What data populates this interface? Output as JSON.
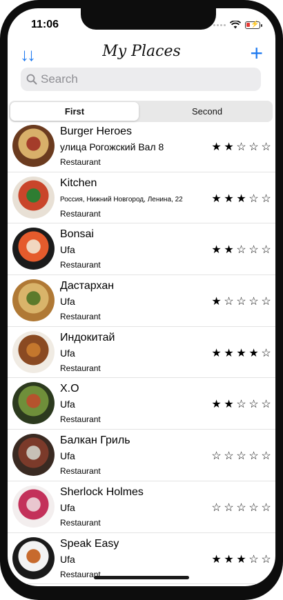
{
  "status_bar": {
    "time": "11:06"
  },
  "nav": {
    "title": "My Places",
    "sort_icon": "↓↓",
    "add_icon": "+"
  },
  "search": {
    "placeholder": "Search"
  },
  "segments": [
    {
      "label": "First"
    },
    {
      "label": "Second"
    }
  ],
  "places": [
    {
      "name": "Burger Heroes",
      "location": "улица Рогожский Вал 8",
      "type": "Restaurant",
      "rating": 2,
      "colors": [
        "#6b3b1f",
        "#d8b06a",
        "#a43c2a"
      ]
    },
    {
      "name": "Kitchen",
      "location": "Россия, Нижний Новгород, Ленина, 22",
      "type": "Restaurant",
      "rating": 3,
      "colors": [
        "#e8e0d5",
        "#c9452a",
        "#2e7d32"
      ]
    },
    {
      "name": "Bonsai",
      "location": "Ufa",
      "type": "Restaurant",
      "rating": 2,
      "colors": [
        "#1b1b1b",
        "#e55b2c",
        "#f1d7c0"
      ]
    },
    {
      "name": "Дастархан",
      "location": "Ufa",
      "type": "Restaurant",
      "rating": 1,
      "colors": [
        "#b07935",
        "#d9b46a",
        "#5c7a2b"
      ]
    },
    {
      "name": "Индокитай",
      "location": "Ufa",
      "type": "Restaurant",
      "rating": 4,
      "colors": [
        "#f0ebe3",
        "#8a4a22",
        "#c4772d"
      ]
    },
    {
      "name": "X.O",
      "location": "Ufa",
      "type": "Restaurant",
      "rating": 2,
      "colors": [
        "#2c3a1e",
        "#6f8f3a",
        "#b5532d"
      ]
    },
    {
      "name": "Балкан Гриль",
      "location": "Ufa",
      "type": "Restaurant",
      "rating": 0,
      "colors": [
        "#3a2a22",
        "#7b3a2a",
        "#c7c0b6"
      ]
    },
    {
      "name": "Sherlock Holmes",
      "location": "Ufa",
      "type": "Restaurant",
      "rating": 0,
      "colors": [
        "#f3eeee",
        "#c3315a",
        "#e9c6cf"
      ]
    },
    {
      "name": "Speak Easy",
      "location": "Ufa",
      "type": "Restaurant",
      "rating": 3,
      "colors": [
        "#1a1a1a",
        "#f3f3f3",
        "#c76a2d"
      ]
    }
  ],
  "colors": {
    "accent": "#1f7af0"
  }
}
